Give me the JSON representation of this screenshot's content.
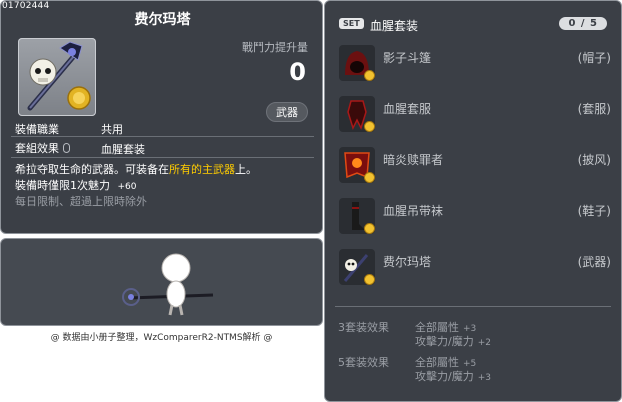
{
  "item": {
    "id": "01702444",
    "title": "费尔玛塔",
    "power_label": "戰鬥力提升量",
    "power_value": "0",
    "category_badge": "武器",
    "job_label": "裝備職業",
    "job_value": "共用",
    "set_label": "套組效果",
    "set_value": "血腥套装",
    "desc_before": "希拉夺取生命的武器。可装备在",
    "desc_highlight": "所有的主武器",
    "desc_after": "上。",
    "limit_text": "裝備時僅限1次魅力",
    "limit_value": "+60",
    "daily_limit": "每日限制、超過上限時除外"
  },
  "credit": "@ 数据由小册子整理，WzComparerR2-NTMS解析 @",
  "set": {
    "tag": "SET",
    "name": "血腥套装",
    "count": "0 / 5",
    "pieces": [
      {
        "name": "影子斗篷",
        "slot": "(帽子)",
        "icon": "hood-icon"
      },
      {
        "name": "血腥套服",
        "slot": "(套服)",
        "icon": "armor-icon"
      },
      {
        "name": "暗炎赎罪者",
        "slot": "(披风)",
        "icon": "cape-icon"
      },
      {
        "name": "血腥吊带袜",
        "slot": "(鞋子)",
        "icon": "stockings-icon"
      },
      {
        "name": "费尔玛塔",
        "slot": "(武器)",
        "icon": "staff-icon"
      }
    ],
    "bonuses": [
      {
        "label": "3套装效果",
        "lines": [
          {
            "stat": "全部屬性",
            "value": "+3"
          },
          {
            "stat": "攻擊力/魔力",
            "value": "+2"
          }
        ]
      },
      {
        "label": "5套装效果",
        "lines": [
          {
            "stat": "全部屬性",
            "value": "+5"
          },
          {
            "stat": "攻擊力/魔力",
            "value": "+3"
          }
        ]
      }
    ]
  }
}
